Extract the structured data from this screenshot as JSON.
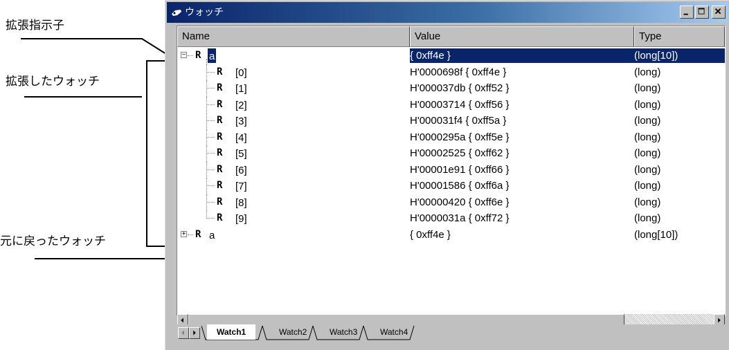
{
  "annotations": {
    "expander_label": "拡張指示子",
    "expanded_label": "拡張したウォッチ",
    "collapsed_label": "元に戻ったウォッチ"
  },
  "window": {
    "title": "ウォッチ",
    "buttons": [
      "minimize",
      "maximize",
      "close"
    ]
  },
  "columns": {
    "name": "Name",
    "value": "Value",
    "type": "Type"
  },
  "rows": [
    {
      "expander": "⊟",
      "icon": "R",
      "name": "a",
      "value": "{ 0xff4e }",
      "type": "(long[10])",
      "selected": true,
      "level": 0
    },
    {
      "icon": "R",
      "name": "[0]",
      "value": "H'0000698f { 0xff4e }",
      "type": "(long)",
      "level": 1
    },
    {
      "icon": "R",
      "name": "[1]",
      "value": "H'000037db { 0xff52 }",
      "type": "(long)",
      "level": 1
    },
    {
      "icon": "R",
      "name": "[2]",
      "value": "H'00003714 { 0xff56 }",
      "type": "(long)",
      "level": 1
    },
    {
      "icon": "R",
      "name": "[3]",
      "value": "H'000031f4 { 0xff5a }",
      "type": "(long)",
      "level": 1
    },
    {
      "icon": "R",
      "name": "[4]",
      "value": "H'0000295a { 0xff5e }",
      "type": "(long)",
      "level": 1
    },
    {
      "icon": "R",
      "name": "[5]",
      "value": "H'00002525 { 0xff62 }",
      "type": "(long)",
      "level": 1
    },
    {
      "icon": "R",
      "name": "[6]",
      "value": "H'00001e91 { 0xff66 }",
      "type": "(long)",
      "level": 1
    },
    {
      "icon": "R",
      "name": "[7]",
      "value": "H'00001586 { 0xff6a }",
      "type": "(long)",
      "level": 1
    },
    {
      "icon": "R",
      "name": "[8]",
      "value": "H'00000420 { 0xff6e }",
      "type": "(long)",
      "level": 1
    },
    {
      "icon": "R",
      "name": "[9]",
      "value": "H'0000031a { 0xff72 }",
      "type": "(long)",
      "level": 1
    },
    {
      "expander": "⊞",
      "icon": "R",
      "name": "a",
      "value": "{ 0xff4e }",
      "type": "(long[10])",
      "level": 0
    }
  ],
  "tabs": [
    {
      "label": "Watch1",
      "active": true
    },
    {
      "label": "Watch2"
    },
    {
      "label": "Watch3"
    },
    {
      "label": "Watch4"
    }
  ],
  "colors": {
    "selection": "#0a246a",
    "face": "#c0c0c0"
  }
}
